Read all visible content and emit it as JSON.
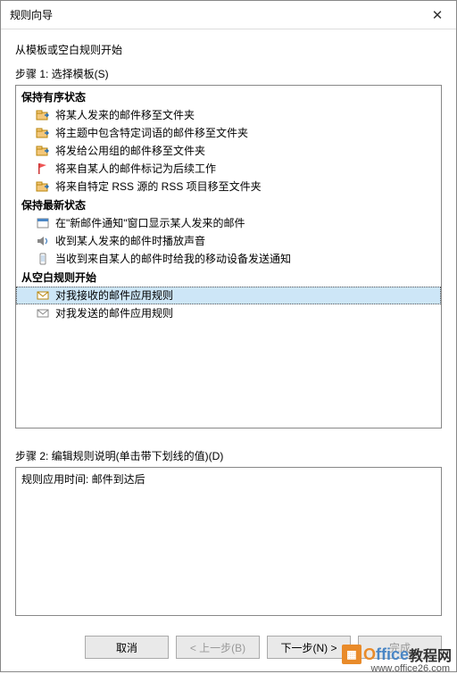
{
  "window": {
    "title": "规则向导",
    "close_label": "✕"
  },
  "intro": "从模板或空白规则开始",
  "step1_label": "步骤 1: 选择模板(S)",
  "groups": {
    "g1": {
      "header": "保持有序状态",
      "items": [
        "将某人发来的邮件移至文件夹",
        "将主题中包含特定词语的邮件移至文件夹",
        "将发给公用组的邮件移至文件夹",
        "将来自某人的邮件标记为后续工作",
        "将来自特定 RSS 源的 RSS 项目移至文件夹"
      ]
    },
    "g2": {
      "header": "保持最新状态",
      "items": [
        "在\"新邮件通知\"窗口显示某人发来的邮件",
        "收到某人发来的邮件时播放声音",
        "当收到来自某人的邮件时给我的移动设备发送通知"
      ]
    },
    "g3": {
      "header": "从空白规则开始",
      "items": [
        "对我接收的邮件应用规则",
        "对我发送的邮件应用规则"
      ]
    }
  },
  "step2_label": "步骤 2: 编辑规则说明(单击带下划线的值)(D)",
  "description": "规则应用时间: 邮件到达后",
  "buttons": {
    "cancel": "取消",
    "back": "< 上一步(B)",
    "next": "下一步(N) >",
    "finish": "完成"
  },
  "watermark": {
    "brand1": "O",
    "brand2": "ffice",
    "brand3": "教程网",
    "url": "www.office26.com"
  }
}
